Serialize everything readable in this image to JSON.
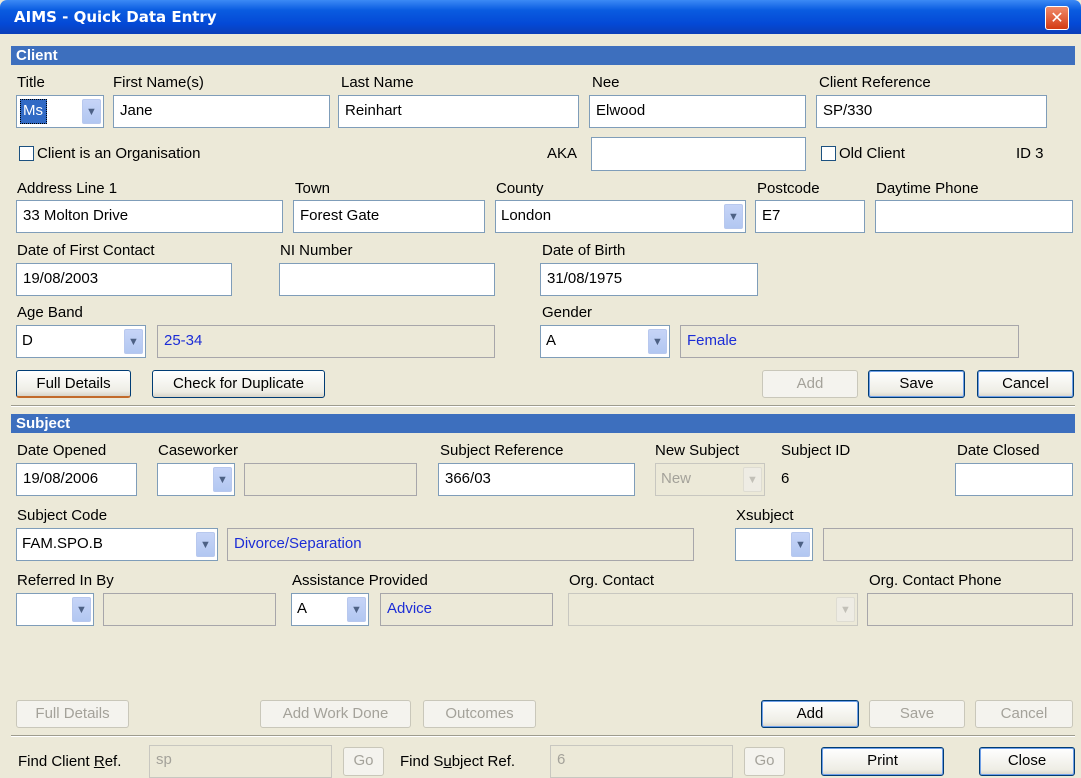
{
  "window": {
    "title": "AIMS - Quick Data Entry",
    "close_glyph": "✕"
  },
  "client": {
    "section_title": "Client",
    "labels": {
      "title": "Title",
      "first_names": "First Name(s)",
      "last_name": "Last Name",
      "nee": "Nee",
      "client_reference": "Client Reference",
      "aka": "AKA",
      "old_client": "Old Client",
      "address1": "Address Line 1",
      "town": "Town",
      "county": "County",
      "postcode": "Postcode",
      "daytime_phone": "Daytime Phone",
      "date_first_contact": "Date of First Contact",
      "ni_number": "NI Number",
      "dob": "Date of Birth",
      "age_band": "Age Band",
      "gender": "Gender",
      "is_org": "Client is an Organisation"
    },
    "title": "Ms",
    "first_names": "Jane",
    "last_name": "Reinhart",
    "nee": "Elwood",
    "client_reference": "SP/330",
    "aka": "",
    "id_text": "ID 3",
    "address1": "33 Molton Drive",
    "town": "Forest Gate",
    "county": "London",
    "postcode": "E7",
    "daytime_phone": "",
    "date_first_contact": "19/08/2003",
    "ni_number": "",
    "dob": "31/08/1975",
    "age_band": "D",
    "age_band_desc": "25-34",
    "gender": "A",
    "gender_desc": "Female",
    "buttons": {
      "full_details": "Full Details",
      "check_duplicate": "Check for Duplicate",
      "add": "Add",
      "save": "Save",
      "cancel": "Cancel"
    }
  },
  "subject": {
    "section_title": "Subject",
    "labels": {
      "date_opened": "Date Opened",
      "caseworker": "Caseworker",
      "subject_reference": "Subject Reference",
      "new_subject": "New Subject",
      "subject_id": "Subject ID",
      "date_closed": "Date Closed",
      "subject_code": "Subject Code",
      "xsubject": "Xsubject",
      "referred_in_by": "Referred In By",
      "assistance_provided": "Assistance Provided",
      "org_contact": "Org. Contact",
      "org_contact_phone": "Org. Contact Phone"
    },
    "date_opened": "19/08/2006",
    "caseworker": "",
    "subject_reference": "366/03",
    "new_subject": "New",
    "subject_id": "6",
    "date_closed": "",
    "subject_code": "FAM.SPO.B",
    "subject_code_desc": "Divorce/Separation",
    "assistance": "A",
    "assistance_desc": "Advice",
    "buttons": {
      "full_details": "Full Details",
      "add_work_done": "Add Work Done",
      "outcomes": "Outcomes",
      "add": "Add",
      "save": "Save",
      "cancel": "Cancel"
    }
  },
  "footer": {
    "find_client_pre": "Find Client ",
    "find_client_u": "R",
    "find_client_post": "ef.",
    "find_client_value": "sp",
    "go": "Go",
    "find_subject_pre": "Find S",
    "find_subject_u": "u",
    "find_subject_post": "bject Ref.",
    "find_subject_value": "6",
    "print": "Print",
    "close": "Close"
  }
}
